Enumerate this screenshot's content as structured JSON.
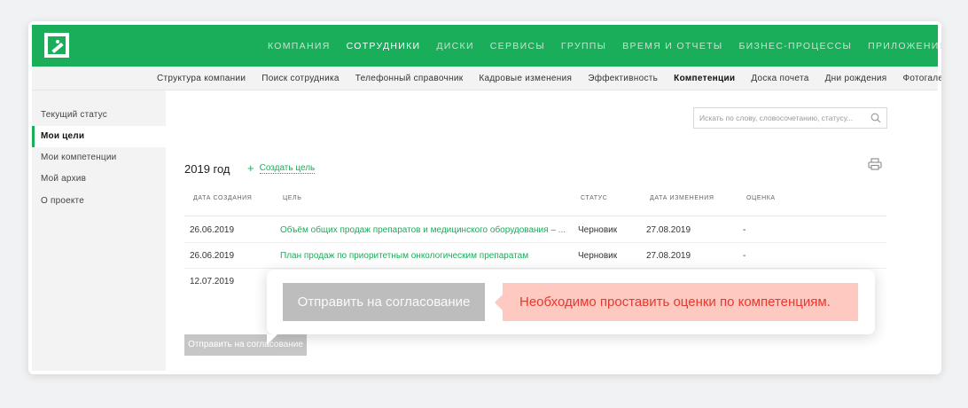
{
  "nav": {
    "items": [
      {
        "label": "КОМПАНИЯ",
        "active": false
      },
      {
        "label": "СОТРУДНИКИ",
        "active": true
      },
      {
        "label": "ДИСКИ",
        "active": false
      },
      {
        "label": "СЕРВИСЫ",
        "active": false
      },
      {
        "label": "ГРУППЫ",
        "active": false
      },
      {
        "label": "ВРЕМЯ И ОТЧЕТЫ",
        "active": false
      },
      {
        "label": "БИЗНЕС-ПРОЦЕССЫ",
        "active": false
      },
      {
        "label": "ПРИЛОЖЕНИЯ",
        "active": false
      }
    ]
  },
  "subnav": {
    "items": [
      {
        "label": "Структура компании",
        "active": false
      },
      {
        "label": "Поиск сотрудника",
        "active": false
      },
      {
        "label": "Телефонный справочник",
        "active": false
      },
      {
        "label": "Кадровые изменения",
        "active": false
      },
      {
        "label": "Эффективность",
        "active": false
      },
      {
        "label": "Компетенции",
        "active": true
      },
      {
        "label": "Доска почета",
        "active": false
      },
      {
        "label": "Дни рождения",
        "active": false
      },
      {
        "label": "Фотогалерея",
        "active": false
      }
    ]
  },
  "sidebar": {
    "items": [
      {
        "label": "Текущий статус",
        "active": false
      },
      {
        "label": "Мои цели",
        "active": true
      },
      {
        "label": "Мои компетенции",
        "active": false
      },
      {
        "label": "Мой архив",
        "active": false
      },
      {
        "label": "О проекте",
        "active": false
      }
    ]
  },
  "search": {
    "placeholder": "Искать по слову, словосочетанию, статусу..."
  },
  "goals": {
    "year": "2019 год",
    "create_label": "Создать цель",
    "columns": [
      "ДАТА СОЗДАНИЯ",
      "ЦЕЛЬ",
      "СТАТУС",
      "ДАТА ИЗМЕНЕНИЯ",
      "ОЦЕНКА"
    ],
    "rows": [
      {
        "created": "26.06.2019",
        "goal": "Объём общих продаж препаратов и медицинского оборудования – ...",
        "status": "Черновик",
        "modified": "27.08.2019",
        "score": "-"
      },
      {
        "created": "26.06.2019",
        "goal": "План продаж по приоритетным онкологическим препаратам",
        "status": "Черновик",
        "modified": "27.08.2019",
        "score": "-"
      },
      {
        "created": "12.07.2019",
        "goal": "",
        "status": "",
        "modified": "",
        "score": ""
      }
    ],
    "submit_label": "Отправить на согласование"
  },
  "popup": {
    "button_label": "Отправить на согласование",
    "error_message": "Необходимо проставить оценки по компетенциям."
  },
  "colors": {
    "accent": "#1aad5a",
    "error_bg": "#fdc9c1",
    "error_text": "#e53a2f"
  }
}
